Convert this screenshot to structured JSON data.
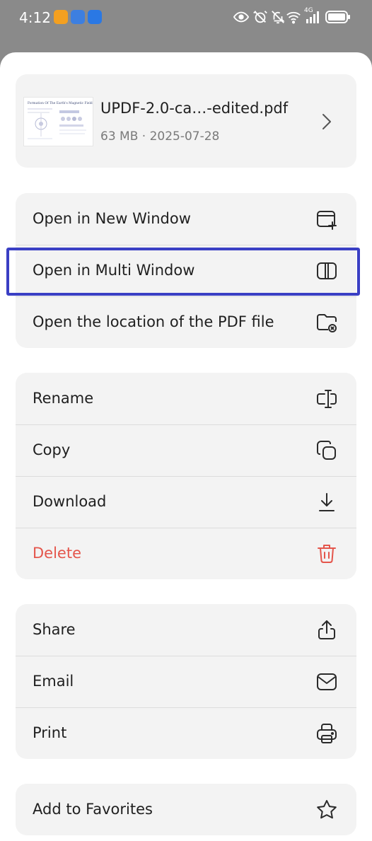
{
  "status_bar": {
    "time": "4:12",
    "network": "4G"
  },
  "file": {
    "name": "UPDF-2.0-ca…-edited.pdf",
    "meta": "63 MB · 2025-07-28",
    "thumb_title": "Formation Of The Earth's Magnetic Field"
  },
  "groups": [
    {
      "items": [
        {
          "label": "Open in New Window",
          "icon": "new-window-icon"
        },
        {
          "label": "Open in Multi Window",
          "icon": "split-window-icon"
        },
        {
          "label": "Open the location of the PDF file",
          "icon": "folder-location-icon"
        }
      ]
    },
    {
      "items": [
        {
          "label": "Rename",
          "icon": "rename-icon"
        },
        {
          "label": "Copy",
          "icon": "copy-icon"
        },
        {
          "label": "Download",
          "icon": "download-icon"
        },
        {
          "label": "Delete",
          "icon": "trash-icon",
          "danger": true
        }
      ]
    },
    {
      "items": [
        {
          "label": "Share",
          "icon": "share-icon"
        },
        {
          "label": "Email",
          "icon": "mail-icon"
        },
        {
          "label": "Print",
          "icon": "printer-icon"
        }
      ]
    },
    {
      "items": [
        {
          "label": "Add to Favorites",
          "icon": "star-icon"
        }
      ]
    }
  ],
  "colors": {
    "danger": "#e4564c",
    "highlight": "#3a3fc4",
    "card": "#f3f3f3"
  }
}
